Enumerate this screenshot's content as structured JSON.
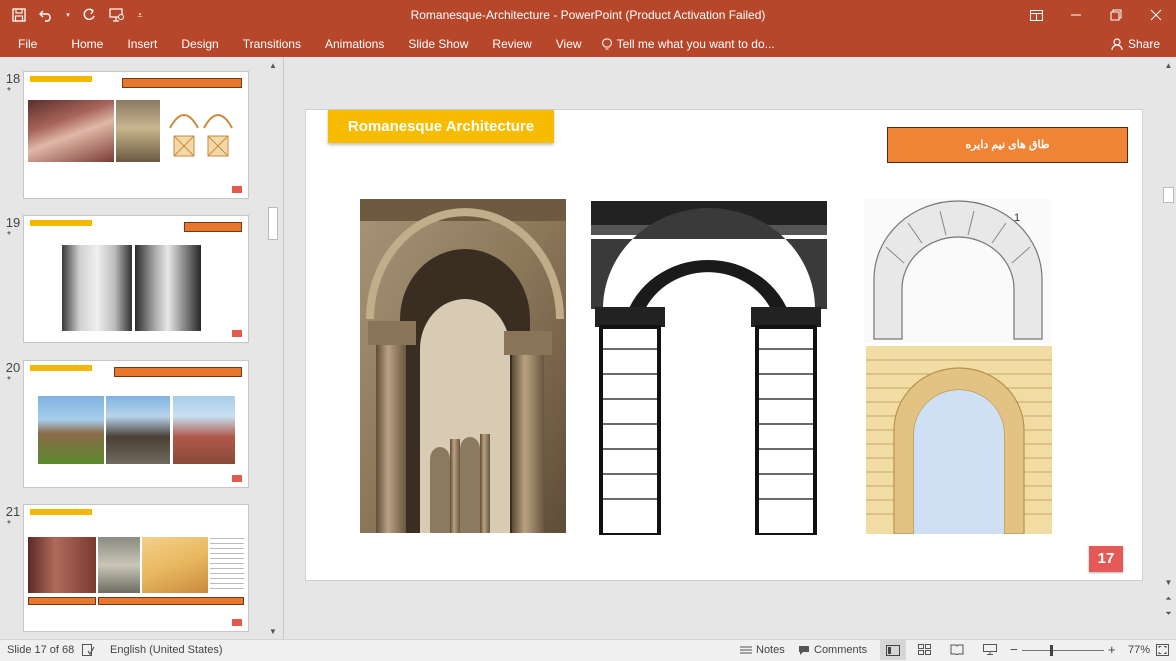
{
  "window": {
    "title": "Romanesque-Architecture - PowerPoint (Product Activation Failed)"
  },
  "ribbon": {
    "tabs": [
      "File",
      "Home",
      "Insert",
      "Design",
      "Transitions",
      "Animations",
      "Slide Show",
      "Review",
      "View"
    ],
    "tell_me": "Tell me what you want to do...",
    "share": "Share"
  },
  "thumbnails": [
    {
      "number": "18",
      "star": "*"
    },
    {
      "number": "19",
      "star": "*"
    },
    {
      "number": "20",
      "star": "*"
    },
    {
      "number": "21",
      "star": "*"
    }
  ],
  "slide": {
    "title": "Romanesque Architecture",
    "subtitle": "طاق های نیم دایره",
    "number": "17"
  },
  "status": {
    "slide_info": "Slide 17 of 68",
    "language": "English (United States)",
    "notes": "Notes",
    "comments": "Comments",
    "zoom": "77%"
  },
  "colors": {
    "accent": "#b7472a",
    "title_box": "#f7bb00",
    "subtitle_box": "#f08436",
    "slide_number": "#e35a56"
  }
}
